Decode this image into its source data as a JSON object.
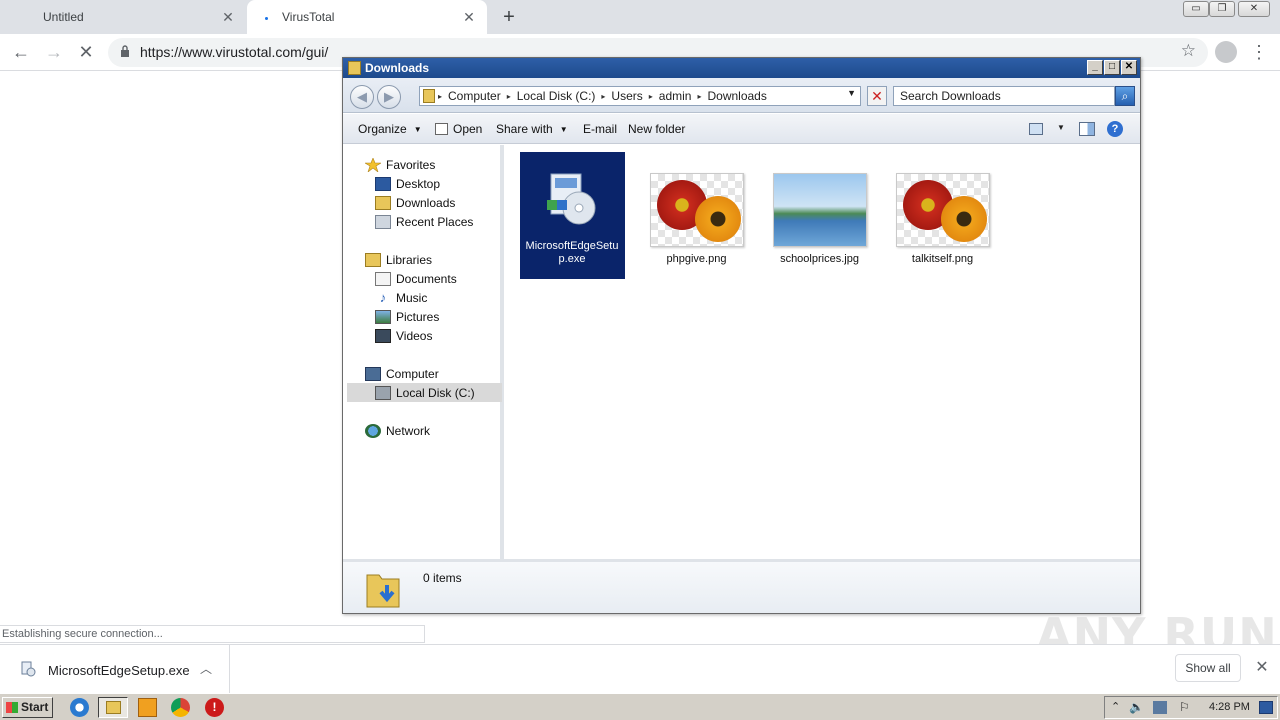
{
  "browser": {
    "tabs": [
      {
        "title": "Untitled",
        "close": "✕"
      },
      {
        "title": "VirusTotal",
        "close": "✕"
      }
    ],
    "new_tab": "+",
    "url": "https://www.virustotal.com/gui/",
    "status": "Establishing secure connection...",
    "window_buttons": [
      "▭",
      "❐",
      "✕"
    ]
  },
  "explorer": {
    "title": "Downloads",
    "breadcrumbs": [
      "Computer",
      "Local Disk (C:)",
      "Users",
      "admin",
      "Downloads"
    ],
    "search_placeholder": "Search Downloads",
    "toolbar": {
      "organize": "Organize",
      "open": "Open",
      "share_with": "Share with",
      "email": "E-mail",
      "new_folder": "New folder"
    },
    "nav": {
      "favorites": "Favorites",
      "desktop": "Desktop",
      "downloads": "Downloads",
      "recent_places": "Recent Places",
      "libraries": "Libraries",
      "documents": "Documents",
      "music": "Music",
      "pictures": "Pictures",
      "videos": "Videos",
      "computer": "Computer",
      "local_disk": "Local Disk (C:)",
      "network": "Network"
    },
    "files": [
      {
        "name": "MicrosoftEdgeSetup.exe",
        "selected": true
      },
      {
        "name": "phpgive.png"
      },
      {
        "name": "schoolprices.jpg"
      },
      {
        "name": "talkitself.png"
      }
    ],
    "item_count": "0 items"
  },
  "download_shelf": {
    "file": "MicrosoftEdgeSetup.exe",
    "show_all": "Show all",
    "close": "✕"
  },
  "watermark": "ANY RUN",
  "taskbar": {
    "start": "Start",
    "clock": "4:28 PM"
  }
}
